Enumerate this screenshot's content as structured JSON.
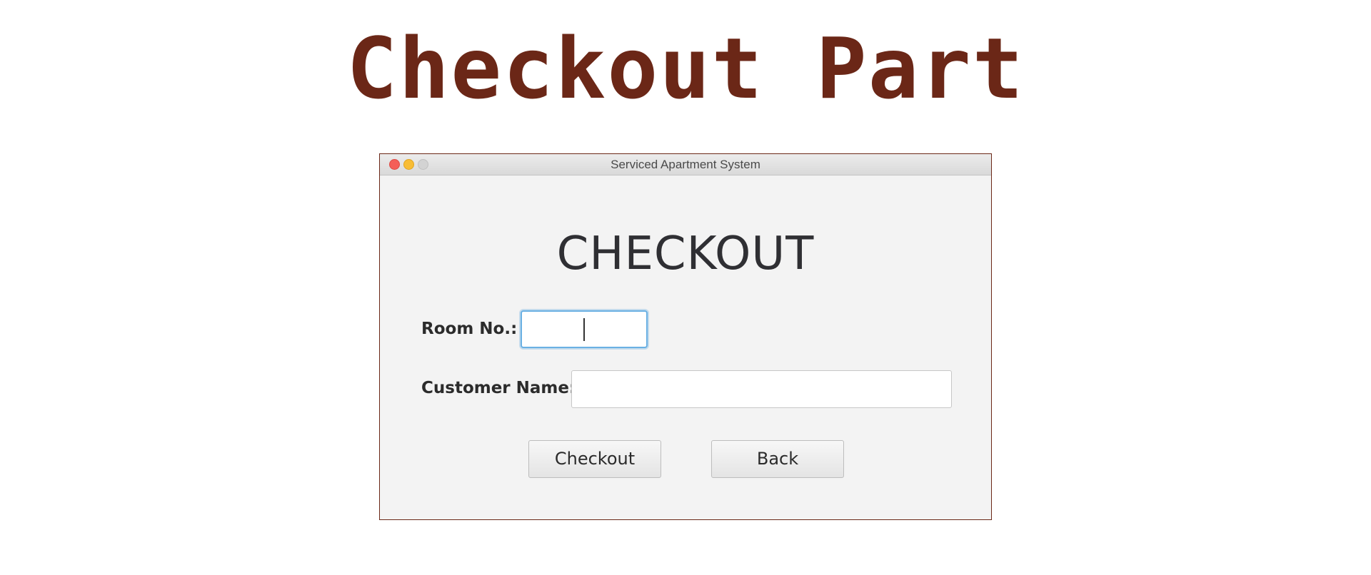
{
  "page": {
    "title": "Checkout Part"
  },
  "window": {
    "title": "Serviced Apartment System",
    "heading": "CHECKOUT"
  },
  "form": {
    "room_label": "Room No.:",
    "room_value": "",
    "customer_label": "Customer Name:",
    "customer_value": ""
  },
  "buttons": {
    "checkout_label": "Checkout",
    "back_label": "Back"
  },
  "colors": {
    "title": "#6b2717",
    "window_border": "#6b2717",
    "focus_ring": "#6ab0e3",
    "close": "#f45e58",
    "minimize": "#f8bd35",
    "maximize": "#d3d3d3"
  }
}
